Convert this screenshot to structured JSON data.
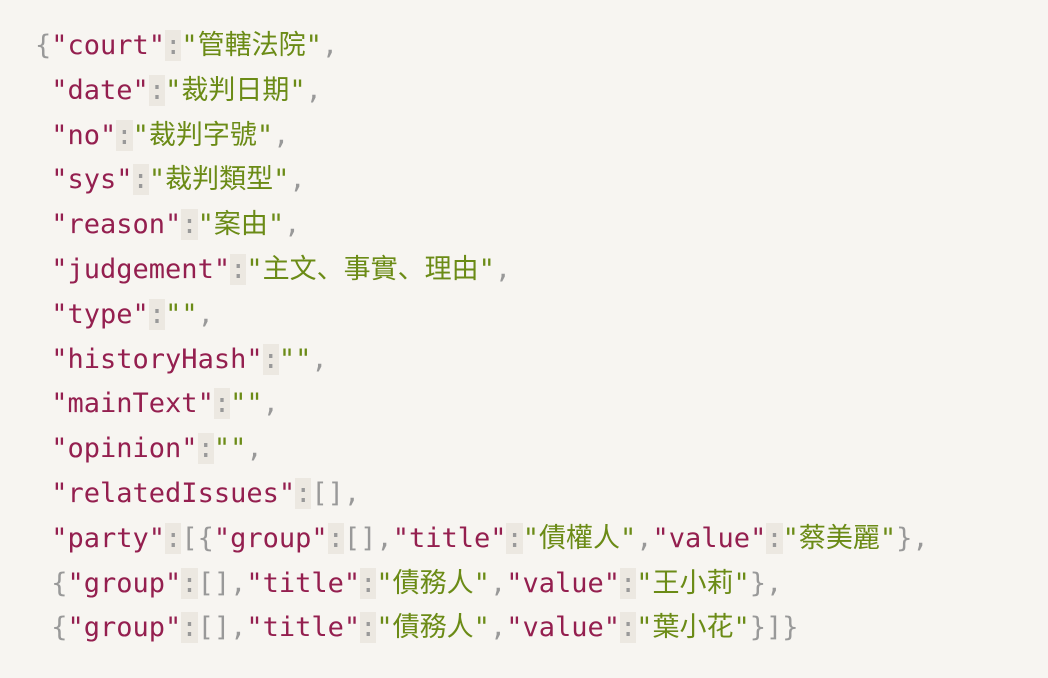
{
  "colors": {
    "background": "#f7f5f1",
    "key": "#941f4f",
    "string": "#6b8b16",
    "punctuation": "#999999",
    "colon_highlight": "#ece8e1"
  },
  "code": {
    "lines": [
      [
        {
          "t": "p",
          "v": "{"
        },
        {
          "t": "k",
          "v": "\"court\""
        },
        {
          "t": "c",
          "v": ":"
        },
        {
          "t": "s",
          "v": "\"管轄法院\""
        },
        {
          "t": "p",
          "v": ","
        }
      ],
      [
        {
          "t": "p",
          "v": " "
        },
        {
          "t": "k",
          "v": "\"date\""
        },
        {
          "t": "c",
          "v": ":"
        },
        {
          "t": "s",
          "v": "\"裁判日期\""
        },
        {
          "t": "p",
          "v": ","
        }
      ],
      [
        {
          "t": "p",
          "v": " "
        },
        {
          "t": "k",
          "v": "\"no\""
        },
        {
          "t": "c",
          "v": ":"
        },
        {
          "t": "s",
          "v": "\"裁判字號\""
        },
        {
          "t": "p",
          "v": ","
        }
      ],
      [
        {
          "t": "p",
          "v": " "
        },
        {
          "t": "k",
          "v": "\"sys\""
        },
        {
          "t": "c",
          "v": ":"
        },
        {
          "t": "s",
          "v": "\"裁判類型\""
        },
        {
          "t": "p",
          "v": ","
        }
      ],
      [
        {
          "t": "p",
          "v": " "
        },
        {
          "t": "k",
          "v": "\"reason\""
        },
        {
          "t": "c",
          "v": ":"
        },
        {
          "t": "s",
          "v": "\"案由\""
        },
        {
          "t": "p",
          "v": ","
        }
      ],
      [
        {
          "t": "p",
          "v": " "
        },
        {
          "t": "k",
          "v": "\"judgement\""
        },
        {
          "t": "c",
          "v": ":"
        },
        {
          "t": "s",
          "v": "\"主文、事實、理由\""
        },
        {
          "t": "p",
          "v": ","
        }
      ],
      [
        {
          "t": "p",
          "v": " "
        },
        {
          "t": "k",
          "v": "\"type\""
        },
        {
          "t": "c",
          "v": ":"
        },
        {
          "t": "s",
          "v": "\"\""
        },
        {
          "t": "p",
          "v": ","
        }
      ],
      [
        {
          "t": "p",
          "v": " "
        },
        {
          "t": "k",
          "v": "\"historyHash\""
        },
        {
          "t": "c",
          "v": ":"
        },
        {
          "t": "s",
          "v": "\"\""
        },
        {
          "t": "p",
          "v": ","
        }
      ],
      [
        {
          "t": "p",
          "v": " "
        },
        {
          "t": "k",
          "v": "\"mainText\""
        },
        {
          "t": "c",
          "v": ":"
        },
        {
          "t": "s",
          "v": "\"\""
        },
        {
          "t": "p",
          "v": ","
        }
      ],
      [
        {
          "t": "p",
          "v": " "
        },
        {
          "t": "k",
          "v": "\"opinion\""
        },
        {
          "t": "c",
          "v": ":"
        },
        {
          "t": "s",
          "v": "\"\""
        },
        {
          "t": "p",
          "v": ","
        }
      ],
      [
        {
          "t": "p",
          "v": " "
        },
        {
          "t": "k",
          "v": "\"relatedIssues\""
        },
        {
          "t": "c",
          "v": ":"
        },
        {
          "t": "p",
          "v": "[],"
        }
      ],
      [
        {
          "t": "p",
          "v": " "
        },
        {
          "t": "k",
          "v": "\"party\""
        },
        {
          "t": "c",
          "v": ":"
        },
        {
          "t": "p",
          "v": "[{"
        },
        {
          "t": "k",
          "v": "\"group\""
        },
        {
          "t": "c",
          "v": ":"
        },
        {
          "t": "p",
          "v": "[],"
        },
        {
          "t": "k",
          "v": "\"title\""
        },
        {
          "t": "c",
          "v": ":"
        },
        {
          "t": "s",
          "v": "\"債權人\""
        },
        {
          "t": "p",
          "v": ","
        },
        {
          "t": "k",
          "v": "\"value\""
        },
        {
          "t": "c",
          "v": ":"
        },
        {
          "t": "s",
          "v": "\"蔡美麗\""
        },
        {
          "t": "p",
          "v": "},"
        }
      ],
      [
        {
          "t": "p",
          "v": " {"
        },
        {
          "t": "k",
          "v": "\"group\""
        },
        {
          "t": "c",
          "v": ":"
        },
        {
          "t": "p",
          "v": "[],"
        },
        {
          "t": "k",
          "v": "\"title\""
        },
        {
          "t": "c",
          "v": ":"
        },
        {
          "t": "s",
          "v": "\"債務人\""
        },
        {
          "t": "p",
          "v": ","
        },
        {
          "t": "k",
          "v": "\"value\""
        },
        {
          "t": "c",
          "v": ":"
        },
        {
          "t": "s",
          "v": "\"王小莉\""
        },
        {
          "t": "p",
          "v": "},"
        }
      ],
      [
        {
          "t": "p",
          "v": " {"
        },
        {
          "t": "k",
          "v": "\"group\""
        },
        {
          "t": "c",
          "v": ":"
        },
        {
          "t": "p",
          "v": "[],"
        },
        {
          "t": "k",
          "v": "\"title\""
        },
        {
          "t": "c",
          "v": ":"
        },
        {
          "t": "s",
          "v": "\"債務人\""
        },
        {
          "t": "p",
          "v": ","
        },
        {
          "t": "k",
          "v": "\"value\""
        },
        {
          "t": "c",
          "v": ":"
        },
        {
          "t": "s",
          "v": "\"葉小花\""
        },
        {
          "t": "p",
          "v": "}]}"
        }
      ]
    ]
  }
}
